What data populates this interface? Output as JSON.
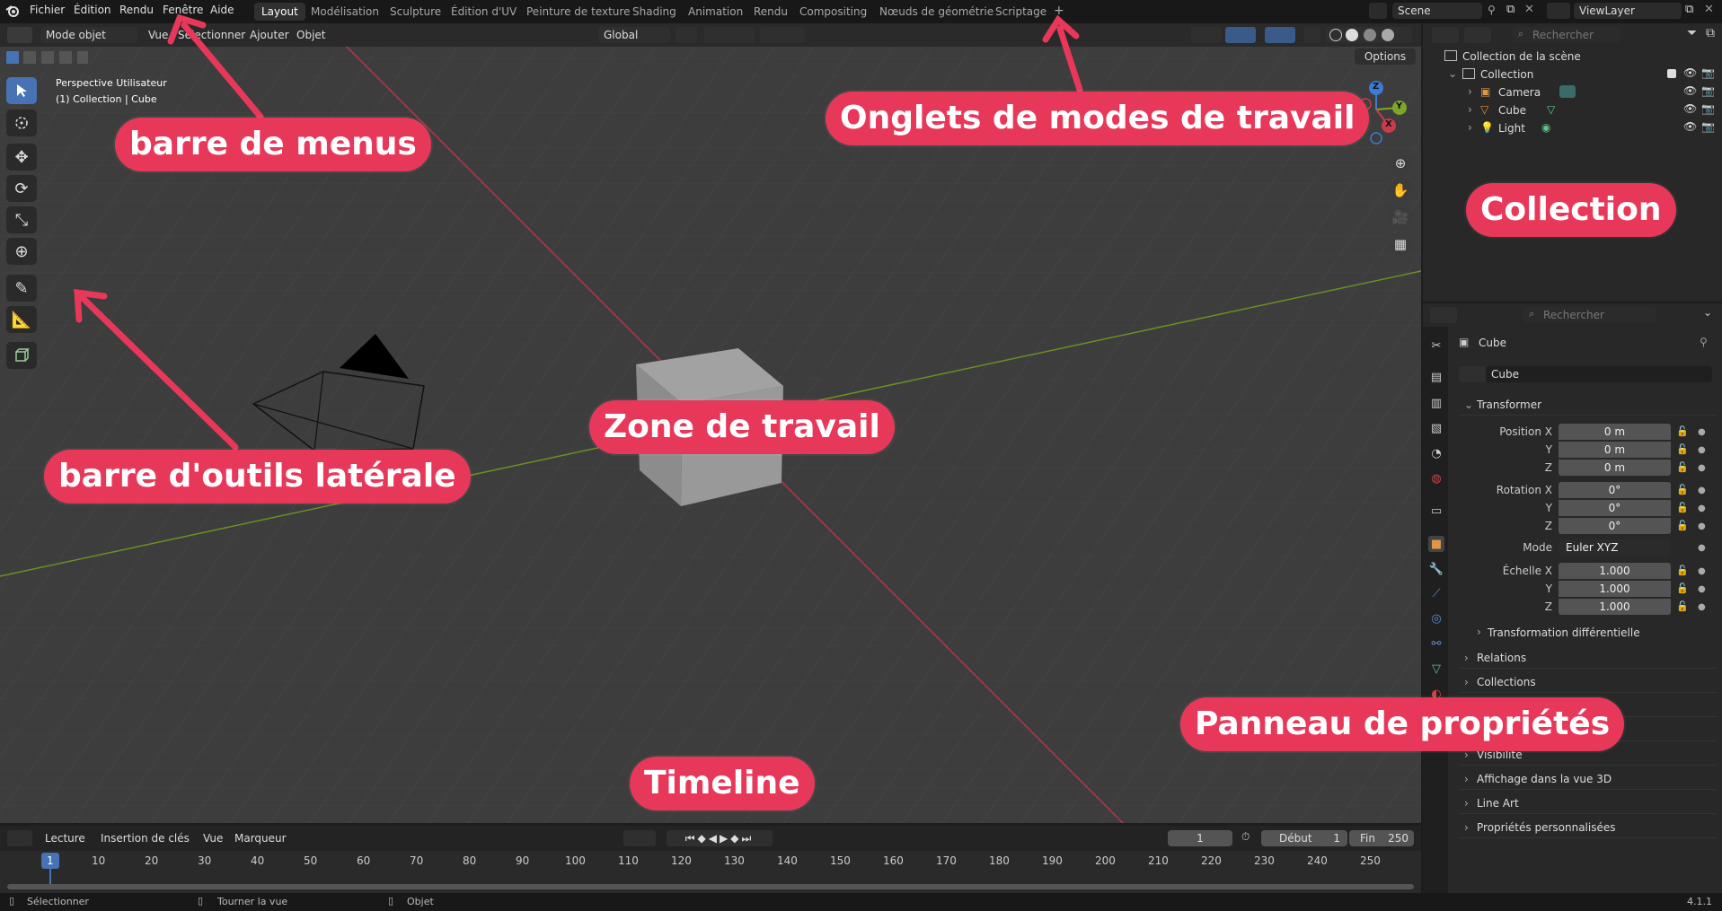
{
  "menubar": {
    "items": [
      "Fichier",
      "Édition",
      "Rendu",
      "Fenêtre",
      "Aide"
    ]
  },
  "workspace_tabs": [
    "Layout",
    "Modélisation",
    "Sculpture",
    "Édition d'UV",
    "Peinture de texture",
    "Shading",
    "Animation",
    "Rendu",
    "Compositing",
    "Nœuds de géométrie",
    "Scriptage"
  ],
  "add_tab_symbol": "+",
  "scene_field": "Scene",
  "viewlayer_field": "ViewLayer",
  "viewport_header": {
    "mode": "Mode objet",
    "menus": [
      "Vue",
      "Sélectionner",
      "Ajouter",
      "Objet"
    ],
    "orientation": "Global",
    "options_label": "Options"
  },
  "viewport_overlay": {
    "line1": "Perspective Utilisateur",
    "line2": "(1) Collection | Cube"
  },
  "gizmo": {
    "z": "Z",
    "y": "Y",
    "x": "X"
  },
  "outliner": {
    "search_placeholder": "Rechercher",
    "scene_collection": "Collection de la scène",
    "collection": "Collection",
    "items": [
      "Camera",
      "Cube",
      "Light"
    ]
  },
  "properties": {
    "search_placeholder": "Rechercher",
    "object_name": "Cube",
    "data_name": "Cube",
    "transform_header": "Transformer",
    "position_label": "Position X",
    "rotation_label": "Rotation X",
    "scale_label": "Échelle X",
    "y_label": "Y",
    "z_label": "Z",
    "position": [
      "0 m",
      "0 m",
      "0 m"
    ],
    "rotation": [
      "0°",
      "0°",
      "0°"
    ],
    "mode_label": "Mode",
    "mode_value": "Euler XYZ",
    "scale": [
      "1.000",
      "1.000",
      "1.000"
    ],
    "delta_transform": "Transformation différentielle",
    "sections": [
      "Relations",
      "Collections",
      "Visibilité",
      "Affichage dans la vue 3D",
      "Line Art",
      "Propriétés personnalisées"
    ]
  },
  "timeline": {
    "menus": [
      "Lecture",
      "Insertion de clés",
      "Vue",
      "Marqueur"
    ],
    "current_frame": "1",
    "start_label": "Début",
    "start_value": "1",
    "end_label": "Fin",
    "end_value": "250",
    "ticks": [
      "1",
      "10",
      "20",
      "30",
      "40",
      "50",
      "60",
      "70",
      "80",
      "90",
      "100",
      "110",
      "120",
      "130",
      "140",
      "150",
      "160",
      "170",
      "180",
      "190",
      "200",
      "210",
      "220",
      "230",
      "240",
      "250"
    ]
  },
  "statusbar": {
    "items": [
      "Sélectionner",
      "Tourner la vue",
      "Objet"
    ],
    "version": "4.1.1"
  },
  "annotations": {
    "menubar": "barre de menus",
    "workspaces": "Onglets de modes de travail",
    "collection": "Collection",
    "sidebar": "barre d'outils latérale",
    "workarea": "Zone de travail",
    "timeline": "Timeline",
    "properties": "Panneau de propriétés"
  },
  "colors": {
    "accent": "#e8385a",
    "active_blue": "#4772b3",
    "x_axis": "#c83c4a",
    "y_axis": "#7da629",
    "z_axis": "#3b7ad6"
  }
}
